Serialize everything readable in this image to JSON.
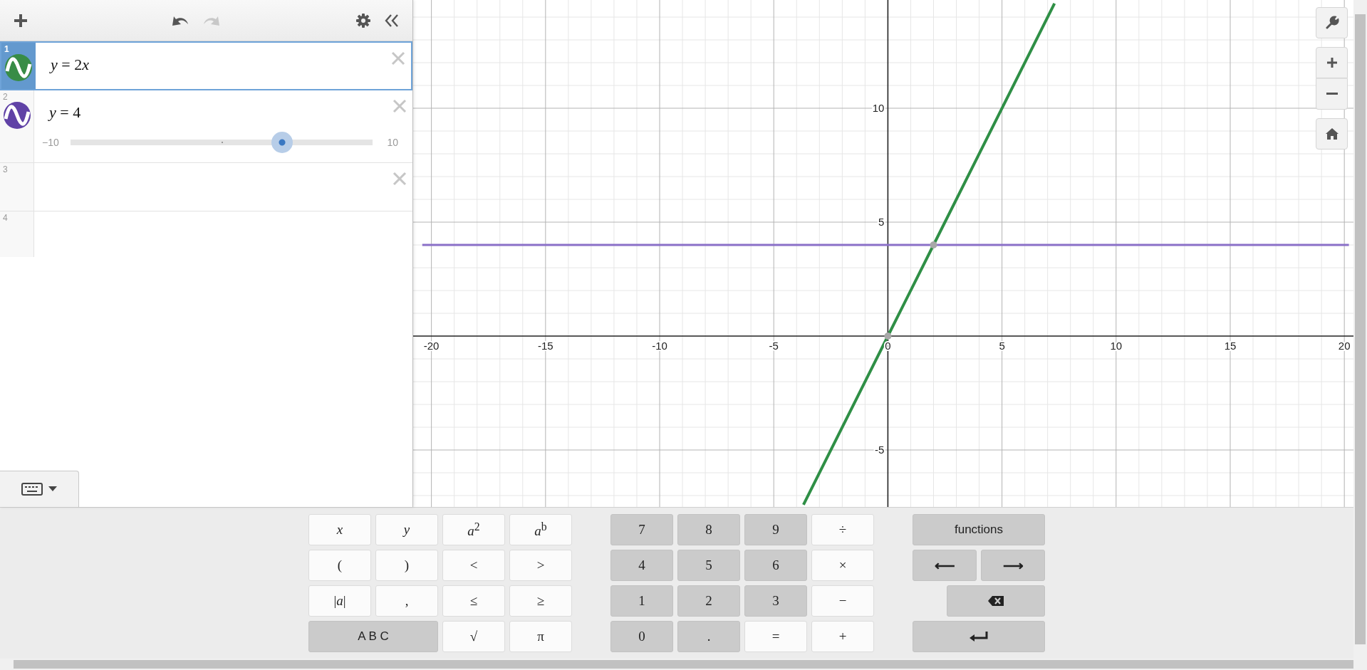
{
  "toolbar": {
    "redo": {
      "disabled": true
    }
  },
  "expressions": [
    {
      "kind": "expression",
      "number": "1",
      "latex": [
        "*y* = 2",
        "*x*"
      ],
      "color": "#388c46",
      "selected": true
    },
    {
      "kind": "slider",
      "number": "2",
      "latex": [
        "*y* = 4"
      ],
      "color": "#6042a6",
      "selected": false,
      "slider": {
        "min": "−10",
        "max": "10",
        "level": 0.7
      }
    },
    {
      "kind": "empty",
      "number": "3",
      "selected": false
    },
    {
      "kind": "new",
      "number": "4",
      "selected": false
    }
  ],
  "graph": {
    "chart_data": {
      "type": "line",
      "grid": true,
      "x": [
        -20.4,
        -3.7,
        0,
        2,
        7.3,
        20.2
      ],
      "series": [
        {
          "color": "#2f8f46",
          "values": [
            null,
            -7.4,
            0,
            4,
            14.6,
            null
          ]
        },
        {
          "color": "#8a70c8",
          "values": [
            4,
            4,
            4,
            4,
            4,
            4
          ]
        }
      ],
      "xlim": [
        -20.8,
        20.4
      ],
      "ylim": [
        -7.5,
        14.75
      ],
      "xticks": [
        {
          "value": -20,
          "label": "-20"
        },
        {
          "value": -15,
          "label": "-15"
        },
        {
          "value": -10,
          "label": "-10"
        },
        {
          "value": -5,
          "label": "-5"
        },
        {
          "value": 0,
          "label": "0"
        },
        {
          "value": 5,
          "label": "5"
        },
        {
          "value": 10,
          "label": "10"
        },
        {
          "value": 15,
          "label": "15"
        },
        {
          "value": 20,
          "label": "20"
        }
      ],
      "yticks": [
        {
          "value": -5,
          "label": "-5"
        },
        {
          "value": 5,
          "label": "5"
        },
        {
          "value": 10,
          "label": "10"
        }
      ]
    }
  },
  "keypad": {
    "groups": [
      [
        {
          "kind": "var",
          "label": "x"
        },
        {
          "kind": "var",
          "label": "y"
        },
        {
          "kind": "math",
          "label": "*a*$^{2}$"
        },
        {
          "kind": "math",
          "label": "*a*$^{b}$"
        },
        {
          "kind": "sym",
          "label": "("
        },
        {
          "kind": "sym",
          "label": ")"
        },
        {
          "kind": "sym",
          "label": "<"
        },
        {
          "kind": "sym",
          "label": ">"
        },
        {
          "kind": "math",
          "label": "|*a*|"
        },
        {
          "kind": "sym",
          "label": ","
        },
        {
          "kind": "sym",
          "label": "≤"
        },
        {
          "kind": "sym",
          "label": "≥"
        },
        {
          "kind": "wide",
          "label": "A B C"
        },
        {
          "kind": "sym",
          "label": "√"
        },
        {
          "kind": "sym",
          "label": "π"
        }
      ],
      [
        {
          "kind": "digit",
          "label": "7"
        },
        {
          "kind": "digit",
          "label": "8"
        },
        {
          "kind": "digit",
          "label": "9"
        },
        {
          "kind": "sym",
          "label": "÷"
        },
        {
          "kind": "digit",
          "label": "4"
        },
        {
          "kind": "digit",
          "label": "5"
        },
        {
          "kind": "digit",
          "label": "6"
        },
        {
          "kind": "sym",
          "label": "×"
        },
        {
          "kind": "digit",
          "label": "1"
        },
        {
          "kind": "digit",
          "label": "2"
        },
        {
          "kind": "digit",
          "label": "3"
        },
        {
          "kind": "sym",
          "label": "−"
        },
        {
          "kind": "digit",
          "label": "0"
        },
        {
          "kind": "digit",
          "label": "."
        },
        {
          "kind": "sym",
          "label": "="
        },
        {
          "kind": "sym",
          "label": "+"
        }
      ],
      [
        {
          "kind": "fn",
          "label": "functions"
        },
        {
          "kind": "arrow",
          "label": "⟵"
        },
        {
          "kind": "arrow",
          "label": "⟶"
        },
        {
          "kind": "backspace"
        },
        {
          "kind": "enter"
        }
      ]
    ]
  }
}
